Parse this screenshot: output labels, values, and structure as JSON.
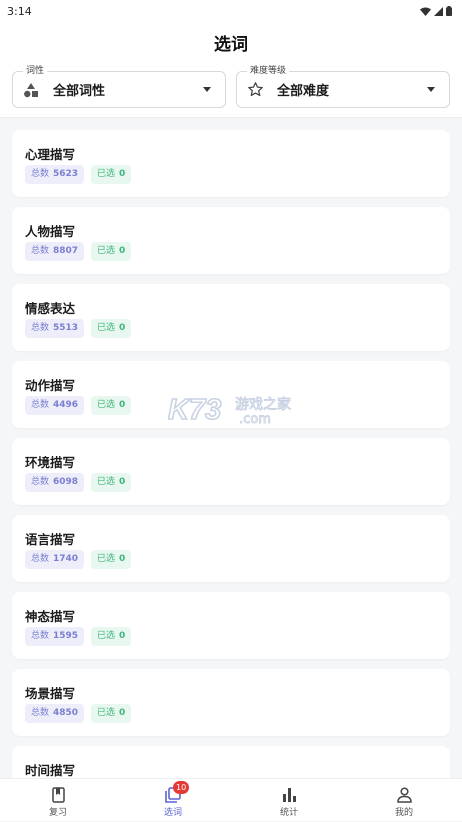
{
  "status_bar": {
    "time": "3:14"
  },
  "header": {
    "title": "选词"
  },
  "filters": {
    "pos": {
      "legend": "词性",
      "value": "全部词性",
      "icon": "shapes-icon"
    },
    "difficulty": {
      "legend": "难度等级",
      "value": "全部难度",
      "icon": "star-outline-icon"
    }
  },
  "categories": [
    {
      "name": "心理描写",
      "total_label": "总数",
      "total": "5623",
      "selected_label": "已选",
      "selected": "0"
    },
    {
      "name": "人物描写",
      "total_label": "总数",
      "total": "8807",
      "selected_label": "已选",
      "selected": "0"
    },
    {
      "name": "情感表达",
      "total_label": "总数",
      "total": "5513",
      "selected_label": "已选",
      "selected": "0"
    },
    {
      "name": "动作描写",
      "total_label": "总数",
      "total": "4496",
      "selected_label": "已选",
      "selected": "0"
    },
    {
      "name": "环境描写",
      "total_label": "总数",
      "total": "6098",
      "selected_label": "已选",
      "selected": "0"
    },
    {
      "name": "语言描写",
      "total_label": "总数",
      "total": "1740",
      "selected_label": "已选",
      "selected": "0"
    },
    {
      "name": "神态描写",
      "total_label": "总数",
      "total": "1595",
      "selected_label": "已选",
      "selected": "0"
    },
    {
      "name": "场景描写",
      "total_label": "总数",
      "total": "4850",
      "selected_label": "已选",
      "selected": "0"
    },
    {
      "name": "时间描写",
      "total_label": "总数",
      "total": "",
      "selected_label": "已选",
      "selected": ""
    }
  ],
  "watermark": {
    "logo": "K73",
    "cn": "游戏之家",
    "domain": ".com"
  },
  "bottom_nav": [
    {
      "label": "复习",
      "icon": "book-icon"
    },
    {
      "label": "选词",
      "icon": "library-icon",
      "badge": "10",
      "active": true
    },
    {
      "label": "统计",
      "icon": "bar-chart-icon"
    },
    {
      "label": "我的",
      "icon": "person-icon"
    }
  ],
  "colors": {
    "accent": "#5b63d3",
    "total_tag_bg": "#eeeefb",
    "total_tag_text": "#7b7fcf",
    "selected_tag_bg": "#e8f7ef",
    "selected_tag_text": "#3fb67b",
    "badge": "#e53935"
  }
}
